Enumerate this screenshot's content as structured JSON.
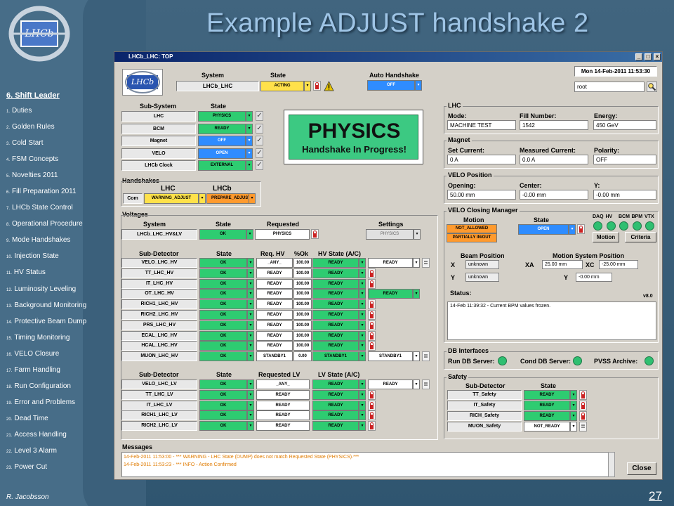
{
  "slide": {
    "title": "Example ADJUST handshake 2",
    "section": "6. Shift Leader",
    "author": "R. Jacobsson",
    "page": "27",
    "toc": [
      {
        "num": "1.",
        "label": "Duties"
      },
      {
        "num": "2.",
        "label": "Golden Rules"
      },
      {
        "num": "3.",
        "label": "Cold Start"
      },
      {
        "num": "4.",
        "label": "FSM Concepts"
      },
      {
        "num": "5.",
        "label": "Novelties 2011"
      },
      {
        "num": "6.",
        "label": "Fill Preparation 2011"
      },
      {
        "num": "7.",
        "label": "LHCb State Control"
      },
      {
        "num": "8.",
        "label": "Operational Procedure"
      },
      {
        "num": "9.",
        "label": "Mode Handshakes"
      },
      {
        "num": "10.",
        "label": "Injection State"
      },
      {
        "num": "11.",
        "label": "HV Status"
      },
      {
        "num": "12.",
        "label": "Luminosity Leveling"
      },
      {
        "num": "13.",
        "label": "Background Monitoring"
      },
      {
        "num": "14.",
        "label": "Protective Beam Dump"
      },
      {
        "num": "15.",
        "label": "Timing Monitoring"
      },
      {
        "num": "16.",
        "label": "VELO Closure"
      },
      {
        "num": "17.",
        "label": "Farm Handling"
      },
      {
        "num": "18.",
        "label": "Run Configuration"
      },
      {
        "num": "19.",
        "label": "Error and Problems"
      },
      {
        "num": "20.",
        "label": "Dead Time"
      },
      {
        "num": "21.",
        "label": "Access Handling"
      },
      {
        "num": "22.",
        "label": "Level 3 Alarm"
      },
      {
        "num": "23.",
        "label": "Power Cut"
      }
    ]
  },
  "window": {
    "title": "LHCb_LHC: TOP",
    "datetime": "Mon 14-Feb-2011    11:53:30",
    "user": "root",
    "logo_text": "LHCb"
  },
  "system": {
    "system_header": "System",
    "state_header": "State",
    "auto_header": "Auto Handshake",
    "name": "LHCb_LHC",
    "state": "ACTING",
    "auto": "OFF"
  },
  "subsystems": {
    "header_name": "Sub-System",
    "header_state": "State",
    "rows": [
      {
        "name": "LHC",
        "state": "PHYSICS"
      },
      {
        "name": "BCM",
        "state": "READY"
      },
      {
        "name": "Magnet",
        "state": "OFF"
      },
      {
        "name": "VELO",
        "state": "OPEN"
      },
      {
        "name": "LHCb Clock",
        "state": "EXTERNAL"
      }
    ]
  },
  "banner": {
    "main": "PHYSICS",
    "sub": "Handshake In Progress!"
  },
  "handshakes": {
    "title": "Handshakes",
    "lhc_header": "LHC",
    "lhcb_header": "LHCb",
    "row_label": "Com",
    "lhc_state": "WARNING_ADJUST",
    "lhcb_state": "PREPARE_ADJUST"
  },
  "voltages": {
    "title": "Voltages",
    "system_header": "System",
    "state_header": "State",
    "requested_header": "Requested",
    "settings_header": "Settings",
    "name": "LHCb_LHC_HV&LV",
    "state": "OK",
    "requested": "PHYSICS",
    "settings": "PHYSICS"
  },
  "hv": {
    "headers": {
      "det": "Sub-Detector",
      "state": "State",
      "req": "Req. HV",
      "ok": "%Ok",
      "hvstate": "HV State (A/C)"
    },
    "rows": [
      {
        "name": "VELO_LHC_HV",
        "state": "OK",
        "req": "_ANY_",
        "ok": "100.00",
        "a": "READY",
        "c": "READY",
        "a_lock": false,
        "c_doc": true
      },
      {
        "name": "TT_LHC_HV",
        "state": "OK",
        "req": "READY",
        "ok": "100.00",
        "a": "READY",
        "c": "",
        "a_lock": true,
        "c_doc": false
      },
      {
        "name": "IT_LHC_HV",
        "state": "OK",
        "req": "READY",
        "ok": "100.00",
        "a": "READY",
        "c": "",
        "a_lock": true,
        "c_doc": false
      },
      {
        "name": "OT_LHC_HV",
        "state": "OK",
        "req": "READY",
        "ok": "100.00",
        "a": "READY",
        "c": "READY",
        "a_lock": false,
        "c_doc": false
      },
      {
        "name": "RICH1_LHC_HV",
        "state": "OK",
        "req": "READY",
        "ok": "100.00",
        "a": "READY",
        "c": "",
        "a_lock": true,
        "c_doc": false
      },
      {
        "name": "RICH2_LHC_HV",
        "state": "OK",
        "req": "READY",
        "ok": "100.00",
        "a": "READY",
        "c": "",
        "a_lock": true,
        "c_doc": false
      },
      {
        "name": "PRS_LHC_HV",
        "state": "OK",
        "req": "READY",
        "ok": "100.00",
        "a": "READY",
        "c": "",
        "a_lock": true,
        "c_doc": false
      },
      {
        "name": "ECAL_LHC_HV",
        "state": "OK",
        "req": "READY",
        "ok": "100.00",
        "a": "READY",
        "c": "",
        "a_lock": true,
        "c_doc": false
      },
      {
        "name": "HCAL_LHC_HV",
        "state": "OK",
        "req": "READY",
        "ok": "100.00",
        "a": "READY",
        "c": "",
        "a_lock": true,
        "c_doc": false
      },
      {
        "name": "MUON_LHC_HV",
        "state": "OK",
        "req": "STANDBY1",
        "ok": "0.00",
        "a": "STANDBY1",
        "c": "STANDBY1",
        "a_lock": false,
        "c_doc": true
      }
    ]
  },
  "lv": {
    "headers": {
      "det": "Sub-Detector",
      "state": "State",
      "req": "Requested LV",
      "lvstate": "LV State (A/C)"
    },
    "rows": [
      {
        "name": "VELO_LHC_LV",
        "state": "OK",
        "req": "_ANY_",
        "a": "READY",
        "c": "READY"
      },
      {
        "name": "TT_LHC_LV",
        "state": "OK",
        "req": "READY",
        "a": "READY",
        "c": ""
      },
      {
        "name": "IT_LHC_LV",
        "state": "OK",
        "req": "READY",
        "a": "READY",
        "c": ""
      },
      {
        "name": "RICH1_LHC_LV",
        "state": "OK",
        "req": "READY",
        "a": "READY",
        "c": ""
      },
      {
        "name": "RICH2_LHC_LV",
        "state": "OK",
        "req": "READY",
        "a": "READY",
        "c": ""
      }
    ]
  },
  "lhc": {
    "title": "LHC",
    "mode_label": "Mode:",
    "mode": "MACHINE TEST",
    "fill_label": "Fill Number:",
    "fill": "1542",
    "energy_label": "Energy:",
    "energy": "450 GeV"
  },
  "magnet": {
    "title": "Magnet",
    "set_label": "Set Current:",
    "set": "0 A",
    "meas_label": "Measured Current:",
    "meas": "0.0 A",
    "pol_label": "Polarity:",
    "pol": "OFF"
  },
  "velo_pos": {
    "title": "VELO Position",
    "open_label": "Opening:",
    "open": "50.00 mm",
    "center_label": "Center:",
    "center": "-0.00 mm",
    "y_label": "Y:",
    "y": "-0.00 mm"
  },
  "velo_cm": {
    "title": "VELO Closing Manager",
    "motion_header": "Motion",
    "state_header": "State",
    "motion1": "NOT_ALLOWED",
    "motion2": "PARTIALLY IN/OUT",
    "state": "OPEN",
    "flags": [
      "DAQ",
      "HV",
      "BCM",
      "BPM",
      "VTX"
    ],
    "motion_btn": "Motion",
    "criteria_btn": "Criteria",
    "beam_title": "Beam Position",
    "x_label": "X",
    "x": "unknown",
    "y_label": "Y",
    "y": "unknown",
    "msp_title": "Motion System Position",
    "xa_label": "XA",
    "xa": "25.00 mm",
    "xc_label": "XC",
    "xc": "-25.00 mm",
    "my_label": "Y",
    "my": "-0.00 mm",
    "status_label": "Status:",
    "version": "v8.0",
    "status_msg": "14-Feb 11:39:32 - Current BPM values frozen."
  },
  "db": {
    "title": "DB Interfaces",
    "run": "Run DB Server:",
    "cond": "Cond DB Server:",
    "pvss": "PVSS Archive:"
  },
  "safety": {
    "title": "Safety",
    "det_header": "Sub-Detector",
    "state_header": "State",
    "rows": [
      {
        "name": "TT_Safety",
        "state": "READY"
      },
      {
        "name": "IT_Safety",
        "state": "READY"
      },
      {
        "name": "RICH_Safety",
        "state": "READY"
      },
      {
        "name": "MUON_Safety",
        "state": "NOT_READY"
      }
    ]
  },
  "messages": {
    "title": "Messages",
    "lines": [
      "14-Feb-2011 11:53:00 - *** WARNING - LHC State (DUMP) does not match Requested State (PHYSICS).***",
      "14-Feb-2011 11:53:23 - *** INFO - Action Confirmed"
    ],
    "close": "Close"
  },
  "colors": {
    "ok_green": "#2ecc71",
    "warn_orange": "#ff9a2e",
    "state_blue": "#2f8cff",
    "acting_yellow": "#ffe14a"
  }
}
